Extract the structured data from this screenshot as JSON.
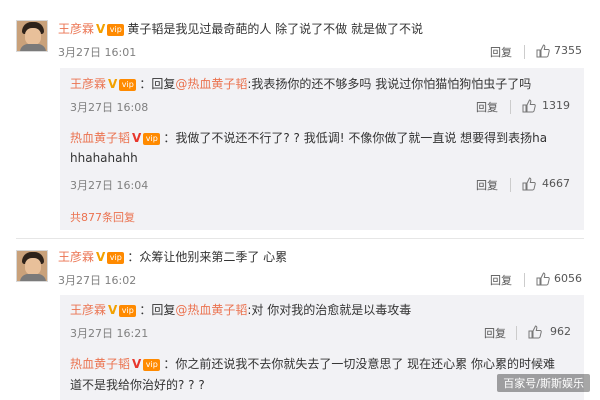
{
  "comments": [
    {
      "user": "王彦霖",
      "badge": "V",
      "member": "vip",
      "text": "黄子韬是我见过最奇葩的人  除了说了不做 就是做了不说",
      "time": "3月27日 16:01",
      "reply_label": "回复",
      "likes": "7355"
    },
    {
      "user": "王彦霖",
      "badge": "V",
      "member": "vip",
      "text": "众筹让他别来第二季了  心累",
      "time": "3月27日 16:02",
      "reply_label": "回复",
      "likes": "6056"
    }
  ],
  "replies_1": [
    {
      "user": "王彦霖",
      "badge": "V",
      "member": "vip",
      "reply_word": "回复",
      "mention": "@热血黄子韬",
      "text": ":我表扬你的还不够多吗 我说过你怕猫怕狗怕虫子了吗",
      "time": "3月27日 16:08",
      "reply_label": "回复",
      "likes": "1319"
    },
    {
      "user": "热血黄子韬",
      "badge": "V",
      "member": "vip",
      "text_line1": "我做了不说还不行了? ?  我低调!  不像你做了就一直说 想要得到表扬ha",
      "text_line2": "hhahahahh",
      "time": "3月27日 16:04",
      "reply_label": "回复",
      "likes": "4667"
    }
  ],
  "more_replies_1": "共877条回复",
  "replies_2": [
    {
      "user": "王彦霖",
      "badge": "V",
      "member": "vip",
      "reply_word": "回复",
      "mention": "@热血黄子韬",
      "text": ":对 你对我的治愈就是以毒攻毒",
      "time": "3月27日 16:21",
      "reply_label": "回复",
      "likes": "962"
    },
    {
      "user": "热血黄子韬",
      "badge": "V",
      "member": "vip",
      "text_line1": "你之前还说我不去你就失去了一切没意思了  现在还心累 你心累的时候难",
      "text_line2": "道不是我给你治好的? ? ?"
    }
  ],
  "watermark": "百家号/斯斯娱乐",
  "colors": {
    "name": "#eb7350",
    "badge_gold": "#f2a100",
    "badge_red": "#e8362b",
    "subbox_bg": "#f2f2f5"
  },
  "icons": [
    "thumb-up-icon",
    "verified-v-icon",
    "member-icon"
  ]
}
